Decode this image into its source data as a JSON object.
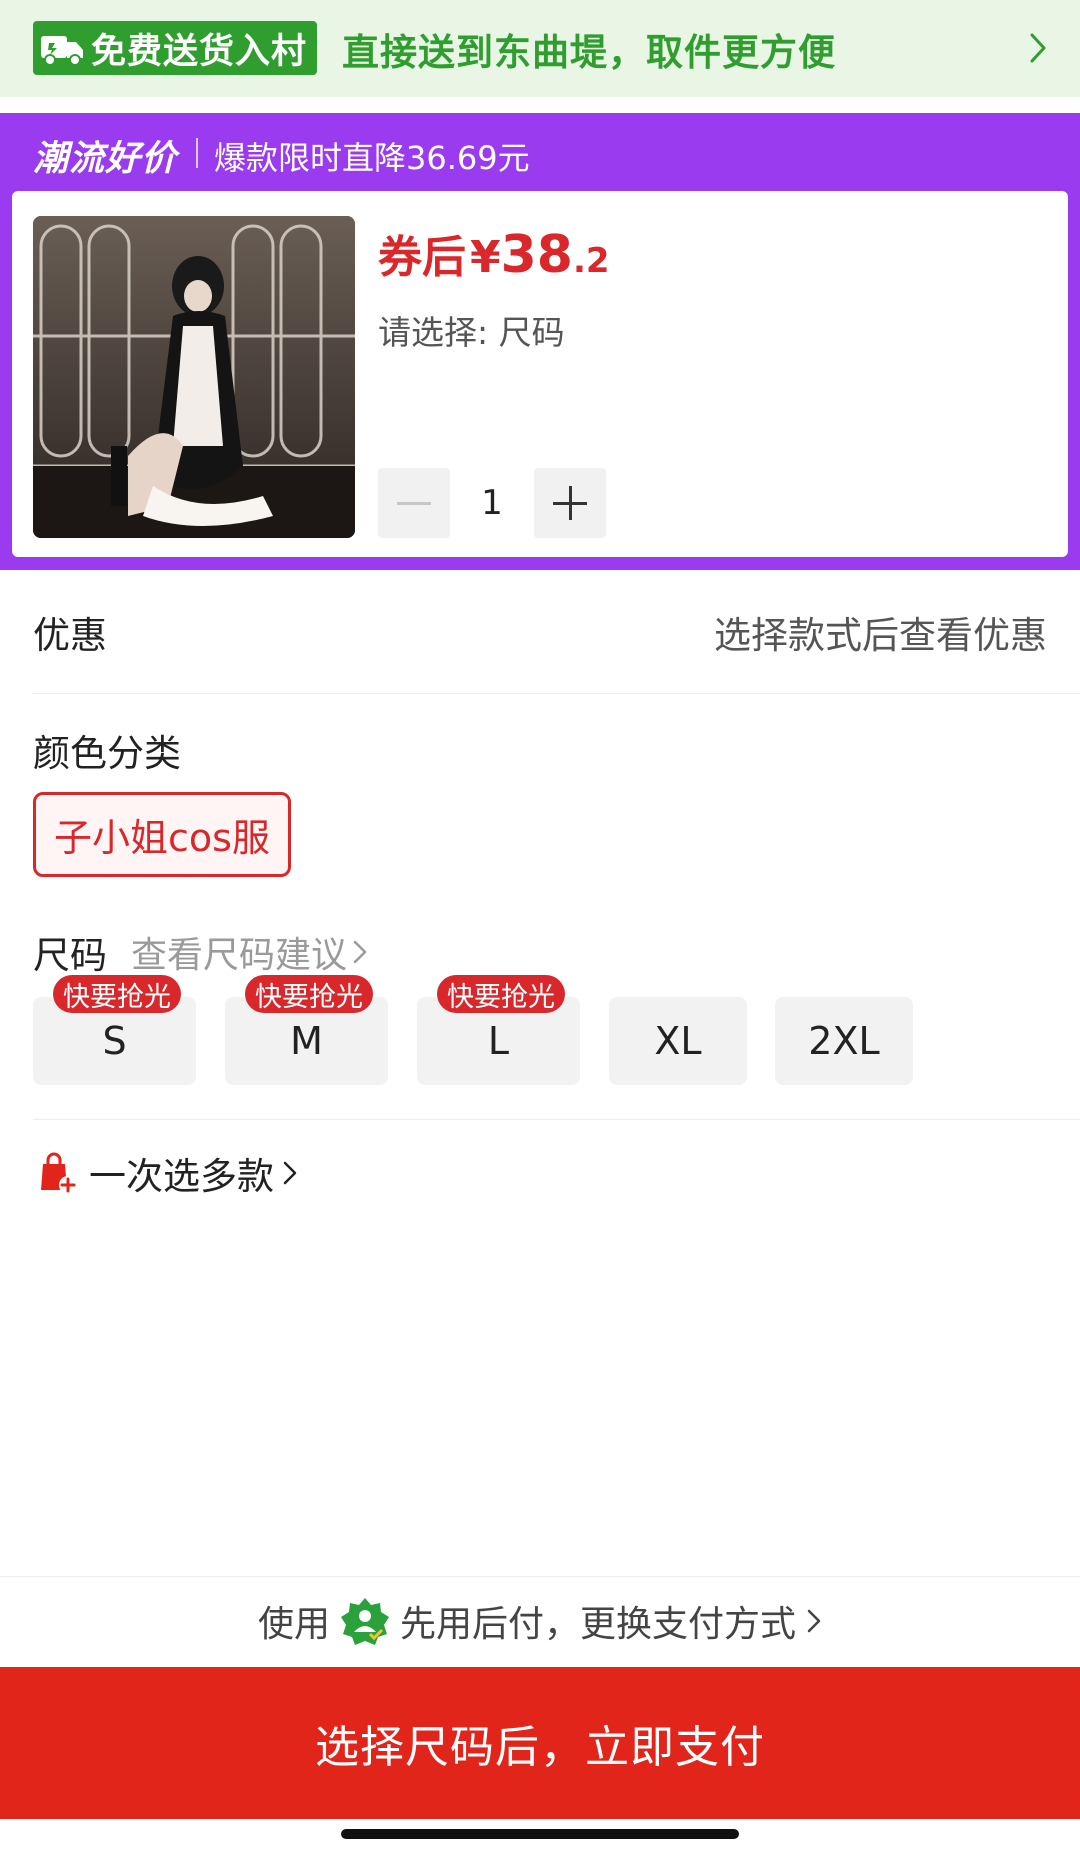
{
  "delivery_banner": {
    "badge_label": "免费送货入村",
    "message": "直接送到东曲堤，取件更方便",
    "badge_icon": "truck-icon",
    "chevron_icon": "chevron-right-icon",
    "color": "#2f9e2f"
  },
  "promo": {
    "brand": "潮流好价",
    "text": "爆款限时直降36.69元",
    "background": "#9b3bf0"
  },
  "product": {
    "price_prefix": "券后",
    "currency": "¥",
    "price_int": "38",
    "price_dec": ".2",
    "spec_hint": "请选择: 尺码",
    "quantity": "1",
    "price_color": "#d8282c"
  },
  "discount": {
    "label": "优惠",
    "value": "选择款式后查看优惠"
  },
  "color_section": {
    "title": "颜色分类",
    "options": [
      "子小姐cos服"
    ],
    "selected": "子小姐cos服"
  },
  "size_section": {
    "title": "尺码",
    "guide_link": "查看尺码建议",
    "options": [
      {
        "label": "S",
        "tag": "快要抢光"
      },
      {
        "label": "M",
        "tag": "快要抢光"
      },
      {
        "label": "L",
        "tag": "快要抢光"
      },
      {
        "label": "XL",
        "tag": ""
      },
      {
        "label": "2XL",
        "tag": ""
      }
    ]
  },
  "multi_select": {
    "label": "一次选多款",
    "icon": "shopping-bag-plus-icon"
  },
  "pay_later": {
    "prefix": "使用",
    "text": "先用后付，更换支付方式",
    "icon": "pay-later-badge-icon"
  },
  "pay_button": {
    "label": "选择尺码后，立即支付",
    "color": "#e1251b"
  }
}
